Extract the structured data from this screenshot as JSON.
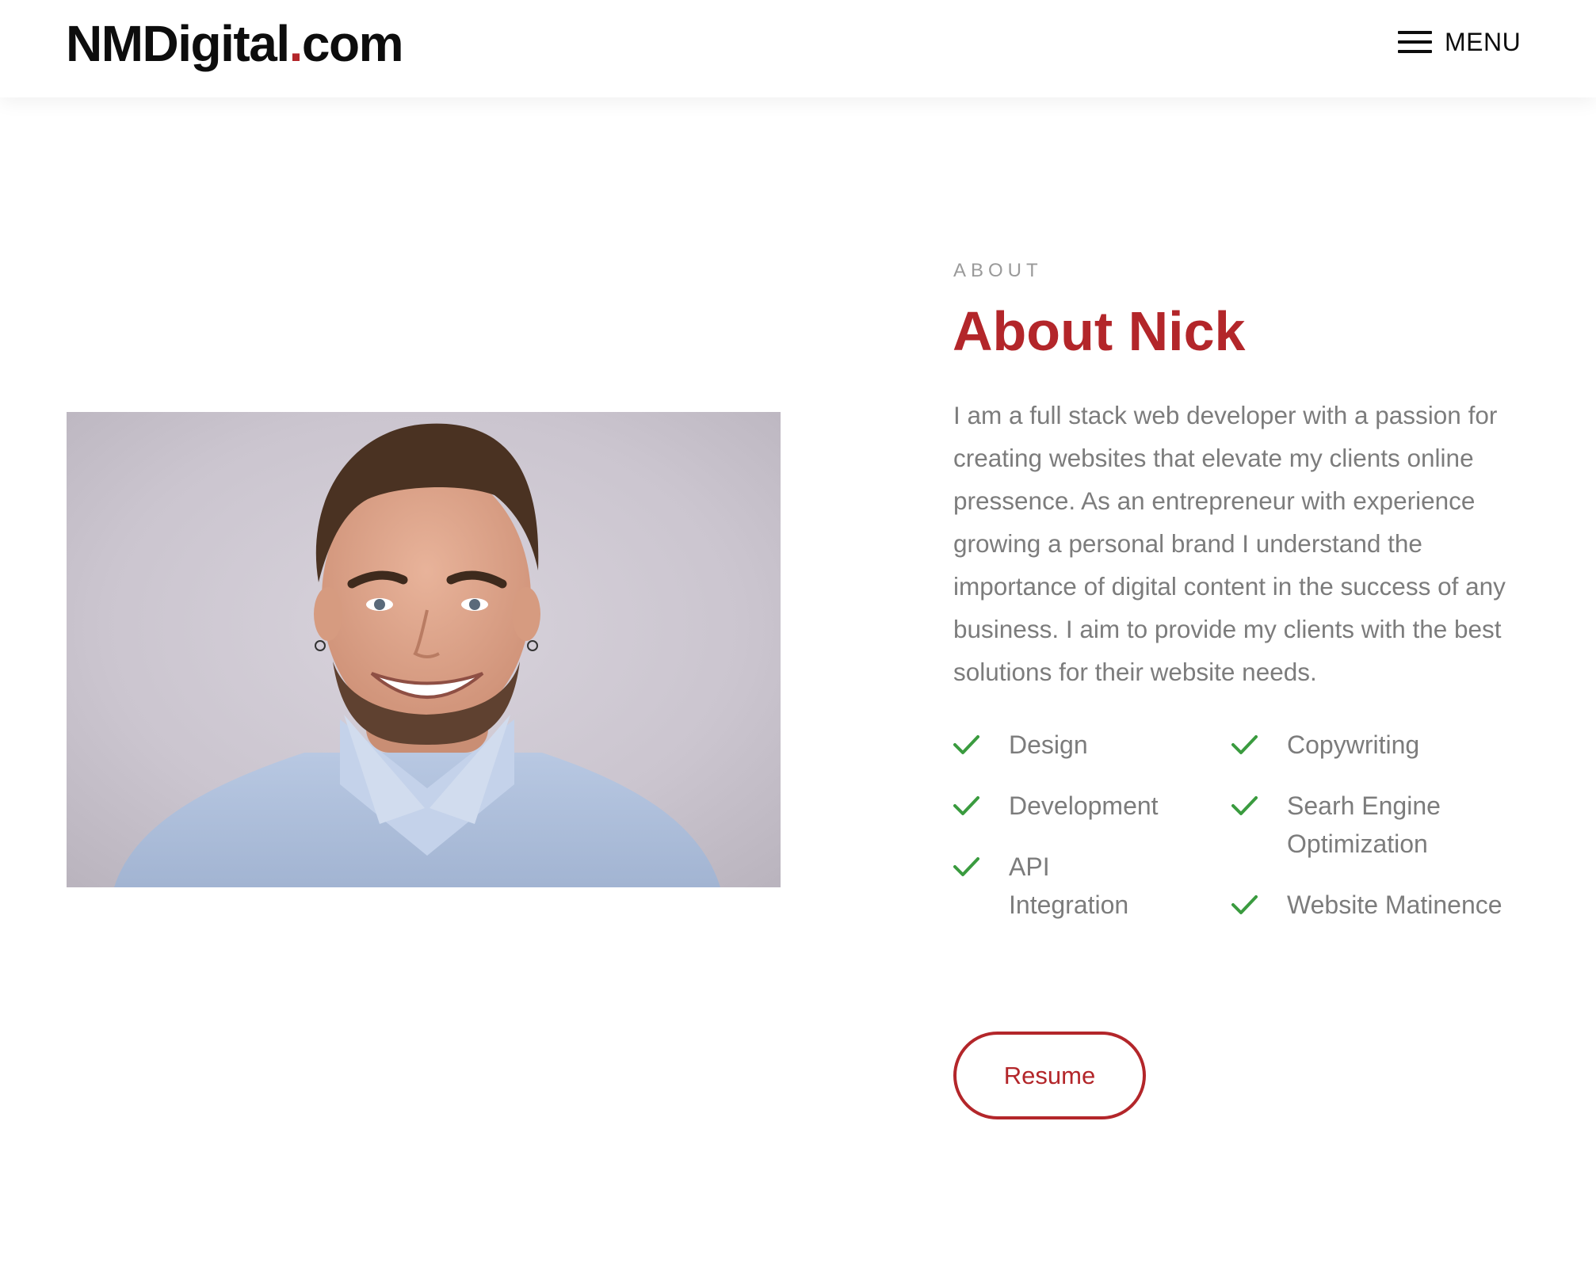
{
  "header": {
    "logo_main": "NMDigital",
    "logo_dot": ".",
    "logo_tld": "com",
    "menu_icon": "hamburger-icon",
    "menu_label": "MENU"
  },
  "about": {
    "eyebrow": "ABOUT",
    "title": "About Nick",
    "bio": "I am a full stack web developer with a passion for creating websites that elevate my clients online pressence. As an entrepreneur with experience growing a personal brand I understand the importance of digital content in the success of any business. I aim to provide my clients with the best solutions for their website needs.",
    "photo_icon": "profile-photo",
    "skills_left": [
      {
        "label": "Design",
        "icon": "check-icon"
      },
      {
        "label": "Development",
        "icon": "check-icon"
      },
      {
        "label": "API Integration",
        "icon": "check-icon"
      }
    ],
    "skills_right": [
      {
        "label": "Copywriting",
        "icon": "check-icon"
      },
      {
        "label": "Searh Engine Optimization",
        "icon": "check-icon"
      },
      {
        "label": "Website Matinence",
        "icon": "check-icon"
      }
    ],
    "resume_label": "Resume"
  },
  "colors": {
    "accent": "#b3262a",
    "check": "#3a9b3f",
    "text_muted": "#7c7c7c",
    "eyebrow": "#9a9a9a",
    "logo": "#0d0d0d"
  }
}
